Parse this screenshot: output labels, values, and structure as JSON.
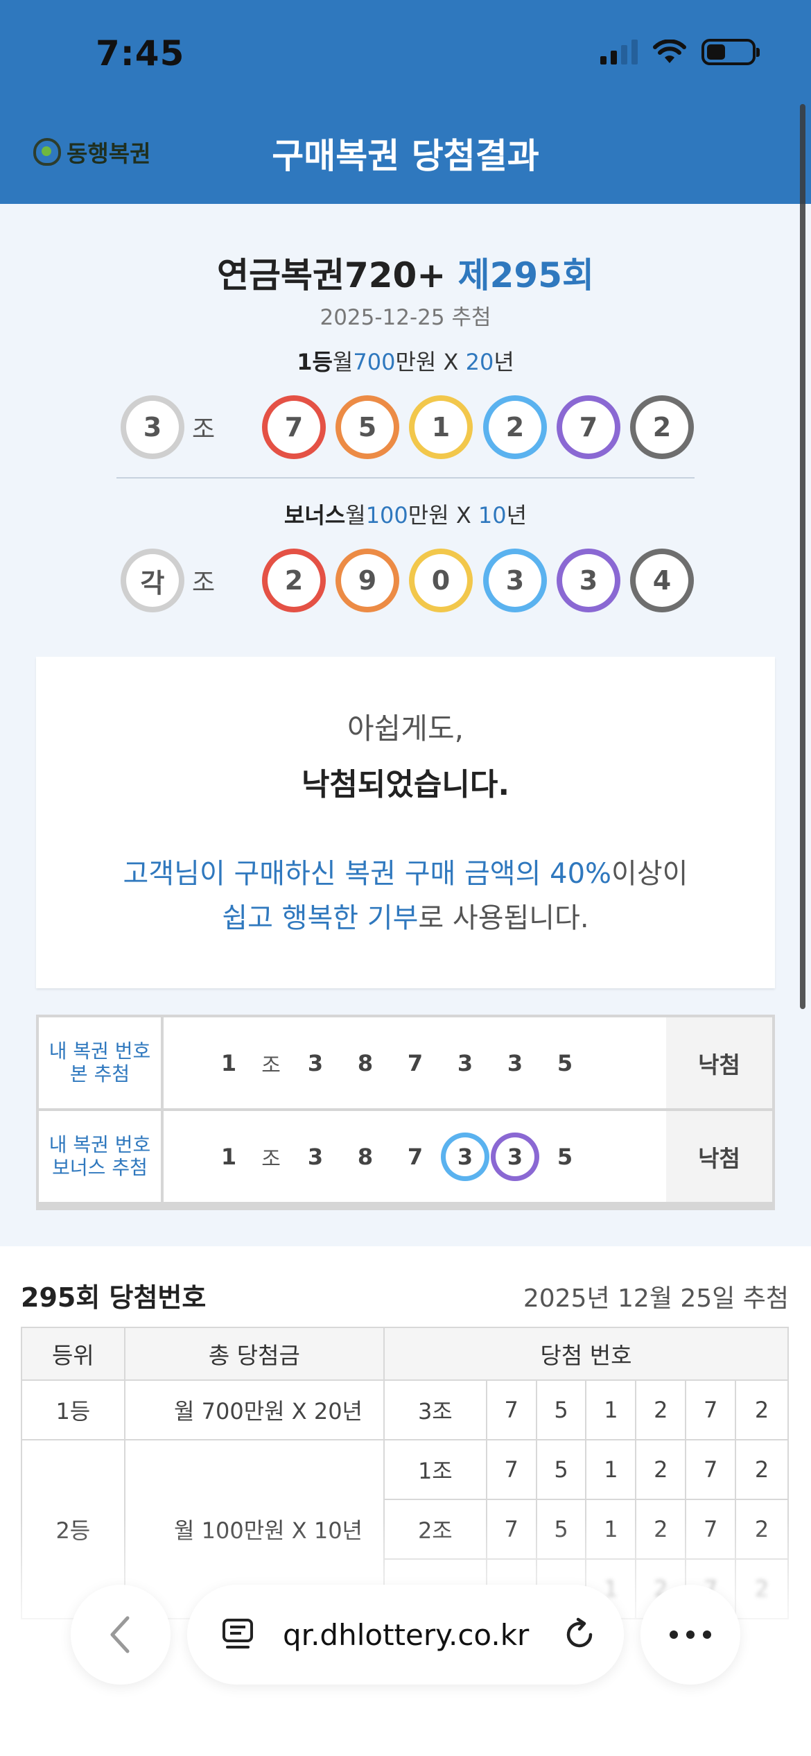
{
  "status": {
    "time": "7:45"
  },
  "header": {
    "logo": "동행복권",
    "title": "구매복권 당첨결과"
  },
  "draw": {
    "name": "연금복권720+ ",
    "round": "제295회",
    "date": "2025-12-25 추첨",
    "first": {
      "rank": "1등",
      "prefix": "월",
      "amount": "700",
      "unit": "만원 X ",
      "years": "20",
      "suffix": "년",
      "group": "3",
      "group_label": "조",
      "numbers": [
        "7",
        "5",
        "1",
        "2",
        "7",
        "2"
      ]
    },
    "bonus": {
      "rank": "보너스",
      "prefix": "월",
      "amount": "100",
      "unit": "만원 X ",
      "years": "10",
      "suffix": "년",
      "group": "각",
      "group_label": "조",
      "numbers": [
        "2",
        "9",
        "0",
        "3",
        "3",
        "4"
      ]
    },
    "ball_colors": [
      "#e45145",
      "#ec8b45",
      "#f2c74b",
      "#5ab2ef",
      "#8a68d3",
      "#6e6e6e"
    ]
  },
  "message": {
    "line1": "아쉽게도,",
    "line2": "낙첨되었습니다.",
    "line3_blue": "고객님이 구매하신 복권 구매 금액의 40%",
    "line3_rest": "이상이",
    "line4_blue": "쉽고 행복한 기부",
    "line4_rest": "로 사용됩니다."
  },
  "my_ticket": {
    "rows": [
      {
        "label1": "내 복권 번호",
        "label2": "본 추첨",
        "group": "1",
        "group_label": "조",
        "numbers": [
          "3",
          "8",
          "7",
          "3",
          "3",
          "5"
        ],
        "result": "낙첨"
      },
      {
        "label1": "내 복권 번호",
        "label2": "보너스 추첨",
        "group": "1",
        "group_label": "조",
        "numbers": [
          "3",
          "8",
          "7",
          "3",
          "3",
          "5"
        ],
        "result": "낙첨",
        "matched_positions": [
          3,
          4
        ]
      }
    ]
  },
  "winning_table": {
    "title": "295회 당첨번호",
    "date": "2025년 12월 25일 추첨",
    "headers": [
      "등위",
      "총 당첨금",
      "당첨 번호"
    ],
    "rows": [
      {
        "rank": "1등",
        "prize": "월 700만원 X 20년",
        "group": "3조",
        "numbers": [
          "7",
          "5",
          "1",
          "2",
          "7",
          "2"
        ]
      },
      {
        "rank": "2등",
        "prize": "월 100만원 X 10년",
        "group": "1조",
        "numbers": [
          "7",
          "5",
          "1",
          "2",
          "7",
          "2"
        ]
      },
      {
        "rank": "",
        "prize": "",
        "group": "2조",
        "numbers": [
          "7",
          "5",
          "1",
          "2",
          "7",
          "2"
        ]
      },
      {
        "rank": "",
        "prize": "",
        "group": "",
        "numbers": [
          "",
          "",
          "1",
          "2",
          "7",
          "2"
        ]
      }
    ]
  },
  "browser": {
    "url": "qr.dhlottery.co.kr"
  }
}
